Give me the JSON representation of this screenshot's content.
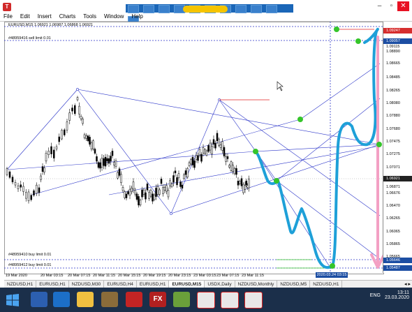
{
  "app": {
    "icon_letter": "T"
  },
  "menu": {
    "items": [
      "File",
      "Edit",
      "Insert",
      "Charts",
      "Tools",
      "Window",
      "Help"
    ]
  },
  "window_controls": {
    "minimize": "–",
    "maximize": "▫",
    "close": "✕"
  },
  "chart": {
    "symbol_line": "EURUSD,M15  1.06921 1.06987 1.06868 1.06921",
    "sell_limit": "#48959416 sell limit 0.01",
    "buy_limit_1": "#48959410 buy limit 0.01",
    "buy_limit_2": "#48959412 buy limit 0.01",
    "crosshair_date": "2020.03.24 03:15",
    "price_labels": [
      "1.09115",
      "1.08890",
      "1.08665",
      "1.08485",
      "1.08265",
      "1.08080",
      "1.07880",
      "1.07680",
      "1.07475",
      "1.07275",
      "1.07071",
      "1.06871",
      "1.06676",
      "1.06470",
      "1.06265",
      "1.06065",
      "1.05865",
      "1.05665",
      "1.05465"
    ],
    "price_boxes": [
      {
        "text": "1.09247",
        "color": "#d62e2e"
      },
      {
        "text": "1.09057",
        "color": "#1c4ea3"
      },
      {
        "text": "1.06921",
        "color": "#222222"
      },
      {
        "text": "1.05646",
        "color": "#1c4ea3"
      },
      {
        "text": "1.05487",
        "color": "#1c4ea3"
      }
    ],
    "time_labels": [
      "19 Mar 2020",
      "20 Mar 03:15",
      "20 Mar 07:15",
      "20 Mar 11:15",
      "20 Mar 15:15",
      "20 Mar 19:15",
      "20 Mar 23:15",
      "23 Mar 03:15",
      "23 Mar 07:15",
      "23 Mar 11:15"
    ]
  },
  "tabs": {
    "items": [
      "NZDUSD,H1",
      "EURUSD,H1",
      "NZDUSD,M30",
      "EURUSD,H4",
      "EURUSD,H1",
      "EURUSD,M15",
      "USDX,Daily",
      "NZDUSD,Monthly",
      "NZDUSD,M5",
      "NZDUSD,H1"
    ],
    "active_index": 5,
    "arrows": "◂ ▸"
  },
  "taskbar": {
    "lang": "ENG",
    "time": "13:11",
    "date": "23.03.2020"
  },
  "colors": {
    "candle": "#000000",
    "wave": "#1ea0d8",
    "pink": "#f3a0c4",
    "line": "#2b35c9",
    "red_line": "#e02020",
    "green_dot": "#35c52a"
  }
}
